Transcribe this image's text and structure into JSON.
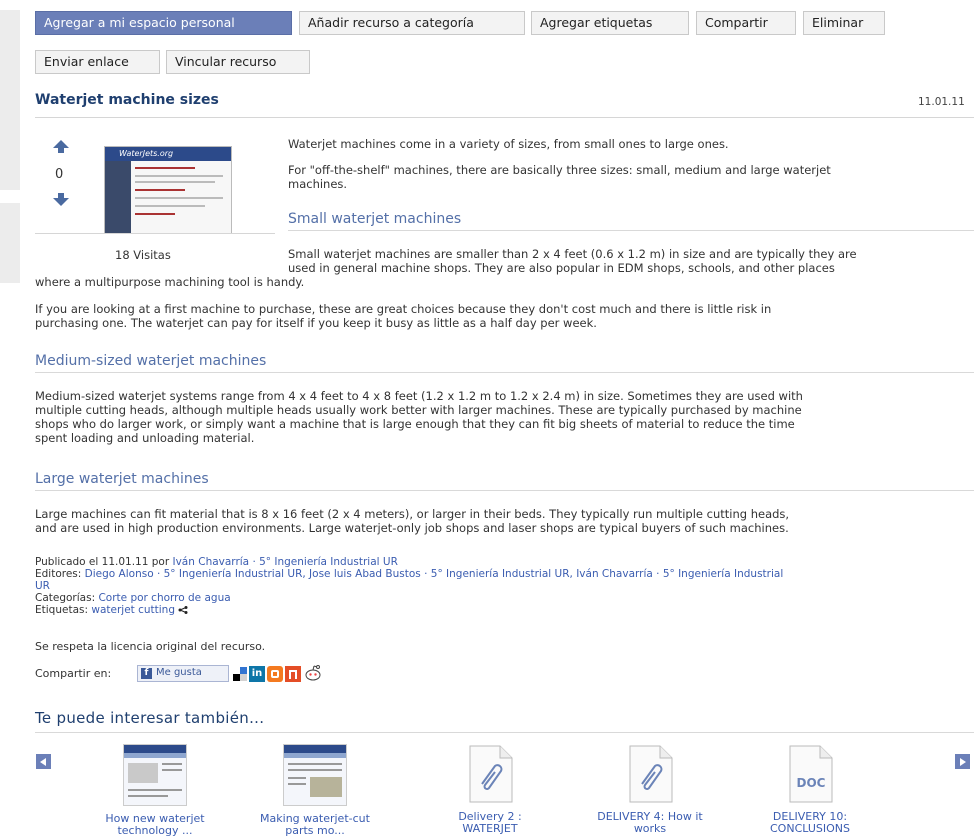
{
  "toolbar": {
    "add_personal": "Agregar a mi espacio personal",
    "add_category": "Añadir recurso a categoría",
    "add_tags": "Agregar etiquetas",
    "share": "Compartir",
    "delete": "Eliminar",
    "send_link": "Enviar enlace",
    "link_resource": "Vincular recurso"
  },
  "resource": {
    "title": "Waterjet machine sizes",
    "date": "11.01.11",
    "votes": "0",
    "visits": "18 Visitas",
    "thumb_banner": "WaterJets.org"
  },
  "content": {
    "p1": "Waterjet machines come in a variety of sizes, from small ones to large ones.",
    "p2a": "For \"off-the-shelf\" machines, there are basically three sizes: small, medium and large waterjet",
    "p2b": "machines.",
    "h_small": "Small waterjet machines",
    "small_a": "Small waterjet machines are smaller than 2 x 4 feet (0.6 x 1.2 m) in size and are typically they are",
    "small_b": "used in general machine shops. They are also popular in EDM shops, schools, and other places",
    "small_c": "where a multipurpose machining tool is handy.",
    "p_first1": "If you are looking at a first machine to purchase, these are great choices because they don't cost much and there is little risk in",
    "p_first2": "purchasing one. The waterjet can pay for itself if you keep it busy as little as a half day per week.",
    "h_medium": "Medium-sized waterjet machines",
    "medium1": "Medium-sized waterjet systems range from 4 x 4 feet to 4 x 8 feet (1.2 x 1.2 m to 1.2 x 2.4 m) in size. Sometimes they are used with",
    "medium2": "multiple cutting heads, although multiple heads usually work better with larger machines. These are typically purchased by machine",
    "medium3": "shops who do larger work, or simply want a machine that is large enough that they can fit big sheets of material to reduce the time",
    "medium4": "spent loading and unloading material.",
    "h_large": "Large waterjet machines",
    "large1": "Large machines can fit material that is 8 x 16 feet (2 x 4 meters), or larger in their beds. They typically run multiple cutting heads,",
    "large2": "and are used in high production environments. Large waterjet-only job shops and laser shops are typical buyers of such machines."
  },
  "meta": {
    "published_prefix": "Publicado el 11.01.11 por",
    "published_author": "Iván Chavarría",
    "published_author_group": " · 5° Ingeniería Industrial UR",
    "editors_label": "Editores:",
    "editors_line1": "Diego Alonso  · 5° Ingeniería Industrial UR, Jose luis Abad Bustos  · 5° Ingeniería Industrial UR, Iván Chavarría  · 5° Ingeniería Industrial",
    "editors_line2": "UR",
    "categories_label": "Categorías:",
    "categories_value": "Corte por chorro de agua",
    "tags_label": "Etiquetas:",
    "tags_value": "waterjet cutting",
    "license": "Se respeta la licencia original del recurso.",
    "share_label": "Compartir en:",
    "like_label": "Me gusta"
  },
  "related": {
    "title": "Te puede interesar también...",
    "items": [
      {
        "line1": "How new waterjet",
        "line2": "technology ..."
      },
      {
        "line1": "Making waterjet-cut",
        "line2": "parts mo..."
      },
      {
        "line1": "Delivery 2 :",
        "line2": "WATERJET"
      },
      {
        "line1": "DELIVERY 4: How it",
        "line2": "works"
      },
      {
        "line1": "DELIVERY 10:",
        "line2": "CONCLUSIONS"
      }
    ],
    "doc_badge": "DOC"
  },
  "colors": {
    "primary_button": "#6b7fb8",
    "title": "#1f3f6f",
    "section_heading": "#5470a8",
    "link": "#3a5cb0"
  }
}
